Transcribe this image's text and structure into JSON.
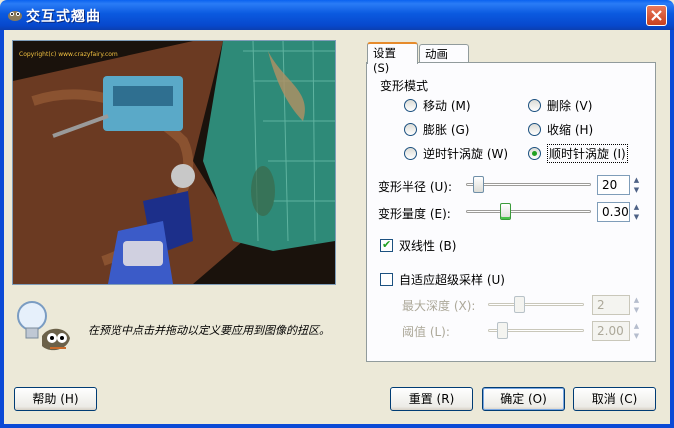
{
  "window": {
    "title": "交互式翘曲"
  },
  "preview": {
    "watermark": "Copyright(c) www.crazyfairy.com"
  },
  "hint": {
    "text": "在预览中点击并拖动以定义要应用到图像的扭区。"
  },
  "tabs": [
    {
      "label": "设置 (S)"
    },
    {
      "label": "动画 (A)"
    }
  ],
  "settings": {
    "deform_mode_label": "变形模式",
    "modes": [
      {
        "label": "移动 (M)",
        "selected": false
      },
      {
        "label": "删除 (V)",
        "selected": false
      },
      {
        "label": "膨胀 (G)",
        "selected": false
      },
      {
        "label": "收缩 (H)",
        "selected": false
      },
      {
        "label": "逆时针涡旋 (W)",
        "selected": false
      },
      {
        "label": "顺时针涡旋 (I)",
        "selected": true
      }
    ],
    "radius": {
      "label": "变形半径 (U):",
      "value": "20",
      "level": 0.06
    },
    "amount": {
      "label": "变形量度 (E):",
      "value": "0.30",
      "level": 0.3
    },
    "bilinear": {
      "label": "双线性 (B)",
      "checked": true
    },
    "adaptive": {
      "label": "自适应超级采样 (U)",
      "checked": false
    },
    "max_depth": {
      "label": "最大深度 (X):",
      "value": "2",
      "level": 0.3
    },
    "threshold": {
      "label": "阈值 (L):",
      "value": "2.00",
      "level": 0.1
    }
  },
  "buttons": {
    "help": "帮助 (H)",
    "reset": "重置 (R)",
    "ok": "确定 (O)",
    "cancel": "取消 (C)"
  },
  "colors": {
    "title_bar": "#0a5ee6",
    "dialog_bg": "#ece9d8",
    "panel_bg": "#fcfcfe",
    "accent_green": "#21a121"
  }
}
